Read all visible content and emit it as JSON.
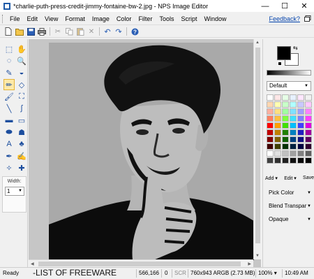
{
  "window": {
    "title": "*charlie-puth-press-credit-jimmy-fontaine-bw-2.jpg - NPS Image Editor",
    "minimize_glyph": "—",
    "maximize_glyph": "☐",
    "close_glyph": "✕"
  },
  "menu": {
    "items": [
      "File",
      "Edit",
      "View",
      "Format",
      "Image",
      "Color",
      "Filter",
      "Tools",
      "Script",
      "Window"
    ],
    "feedback": "Feedback?"
  },
  "toolbar": {
    "icons": [
      "new-file-icon",
      "open-file-icon",
      "save-icon",
      "print-icon",
      "cut-icon",
      "copy-icon",
      "paste-icon",
      "delete-icon",
      "undo-icon",
      "redo-icon",
      "help-icon"
    ]
  },
  "tools": {
    "items": [
      {
        "name": "select-dotted-tool-icon",
        "glyph": "⬚"
      },
      {
        "name": "hand-tool-icon",
        "glyph": "✋"
      },
      {
        "name": "lasso-tool-icon",
        "glyph": "◌"
      },
      {
        "name": "zoom-tool-icon",
        "glyph": "🔍"
      },
      {
        "name": "eyedropper-tool-icon",
        "glyph": "✎"
      },
      {
        "name": "paint-bucket-tool-icon",
        "glyph": "◒"
      },
      {
        "name": "pencil-tool-icon",
        "glyph": "✏"
      },
      {
        "name": "eraser-tool-icon",
        "glyph": "◇"
      },
      {
        "name": "brush-tool-icon",
        "glyph": "🖌"
      },
      {
        "name": "clone-tool-icon",
        "glyph": "⛶"
      },
      {
        "name": "line-tool-icon",
        "glyph": "╲"
      },
      {
        "name": "curve-tool-icon",
        "glyph": "∫"
      },
      {
        "name": "rectangle-tool-icon",
        "glyph": "▬"
      },
      {
        "name": "rounded-rect-tool-icon",
        "glyph": "▭"
      },
      {
        "name": "ellipse-tool-icon",
        "glyph": "⬬"
      },
      {
        "name": "freeform-shape-tool-icon",
        "glyph": "☗"
      },
      {
        "name": "text-tool-icon",
        "glyph": "A"
      },
      {
        "name": "stamp-tool-icon",
        "glyph": "♣"
      },
      {
        "name": "pen-tool-icon",
        "glyph": "✒"
      },
      {
        "name": "smudge-tool-icon",
        "glyph": "✍"
      },
      {
        "name": "magic-wand-tool-icon",
        "glyph": "✧"
      },
      {
        "name": "move-tool-icon",
        "glyph": "✚"
      }
    ],
    "active_index": 6,
    "width_label": "Width:",
    "width_value": "1"
  },
  "colors": {
    "primary": "#000000",
    "secondary": "#ffffff",
    "palette_name": "Default",
    "palette": [
      "#ffffff",
      "#ffe6e6",
      "#e6ffe6",
      "#e6f0ff",
      "#ffe6ff",
      "#f0f0f0",
      "#ffd6b0",
      "#ffffb0",
      "#c8ffc8",
      "#b0ffff",
      "#c8c8ff",
      "#ffc8ff",
      "#ffb0a0",
      "#ffe080",
      "#a0ffa0",
      "#80e0ff",
      "#a0a0ff",
      "#ff80ff",
      "#ff8060",
      "#ffc040",
      "#80ff40",
      "#40e0ff",
      "#8080ff",
      "#ff40ff",
      "#ff0000",
      "#ffa000",
      "#40e000",
      "#00c0ff",
      "#4040ff",
      "#e000e0",
      "#c00000",
      "#c08000",
      "#208000",
      "#0080c0",
      "#2020c0",
      "#a000a0",
      "#800000",
      "#806000",
      "#106000",
      "#004080",
      "#101080",
      "#600060",
      "#400000",
      "#404000",
      "#003000",
      "#002040",
      "#000040",
      "#300030",
      "#ffffff",
      "#e0e0e0",
      "#c0c0c0",
      "#a0a0a0",
      "#808080",
      "#606060",
      "#404040",
      "#303030",
      "#202020",
      "#101010",
      "#080808",
      "#000000"
    ],
    "add_label": "Add",
    "edit_label": "Edit",
    "save_label": "Save",
    "pick_color": "Pick Color",
    "blend": "Blend Transpar",
    "opacity": "Opaque"
  },
  "status": {
    "ready": "Ready",
    "watermark": "-LIST OF FREEWARE",
    "coords": "566,166",
    "zero": "0",
    "scr": "SCR",
    "size": "760x943 ARGB (2.73 MB)",
    "zoom": "100%",
    "time": "10:49 AM"
  }
}
